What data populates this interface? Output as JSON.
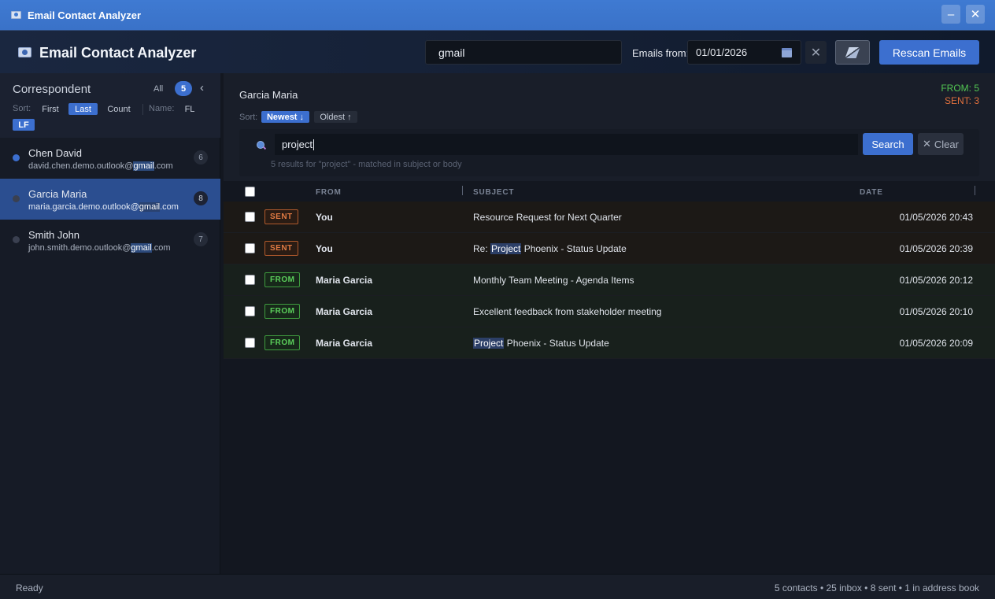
{
  "window": {
    "title": "Email Contact Analyzer",
    "minimize_glyph": "–",
    "close_glyph": "✕"
  },
  "header": {
    "title": "Email Contact Analyzer",
    "search_value": "gmail",
    "emails_from_label": "Emails from:",
    "date_value": "01/01/2026",
    "clear_date_glyph": "✕",
    "rescan_label": "Rescan Emails"
  },
  "sidebar": {
    "title": "Correspondent",
    "all_label": "All",
    "count": "5",
    "collapse_glyph": "‹",
    "sort_label": "Sort:",
    "sort_options": [
      "First",
      "Last",
      "Count"
    ],
    "sort_active": "Last",
    "name_label": "Name:",
    "name_options": [
      "FL",
      "LF"
    ],
    "name_active": "LF",
    "highlight_term": "gmail",
    "contacts": [
      {
        "name": "Chen David",
        "email_prefix": "david.chen.demo.outlook@",
        "email_match": "gmail",
        "email_suffix": ".com",
        "count": "6",
        "dot": "blue",
        "selected": false
      },
      {
        "name": "Garcia Maria",
        "email_prefix": "maria.garcia.demo.outlook@",
        "email_match": "gmail",
        "email_suffix": ".com",
        "count": "8",
        "dot": "grey",
        "selected": true
      },
      {
        "name": "Smith John",
        "email_prefix": "john.smith.demo.outlook@",
        "email_match": "gmail",
        "email_suffix": ".com",
        "count": "7",
        "dot": "grey",
        "selected": false
      }
    ]
  },
  "main": {
    "contact_name": "Garcia Maria",
    "from_stat": "FROM: 5",
    "sent_stat": "SENT: 3",
    "sort_label": "Sort:",
    "sort_newest": "Newest ↓",
    "sort_oldest": "Oldest ↑",
    "search_value": "project",
    "search_button": "Search",
    "clear_button": "Clear",
    "clear_glyph": "✕",
    "results_hint": "5 results for \"project\" - matched in subject or body",
    "columns": {
      "from": "FROM",
      "subject": "SUBJECT",
      "date": "DATE"
    },
    "emails": [
      {
        "type": "sent",
        "badge": "SENT",
        "sender": "You",
        "subject_pre": "",
        "subject_match": "",
        "subject_post": "Resource Request for Next Quarter",
        "date": "01/05/2026 20:43"
      },
      {
        "type": "sent",
        "badge": "SENT",
        "sender": "You",
        "subject_pre": "Re: ",
        "subject_match": "Project",
        "subject_post": " Phoenix - Status Update",
        "date": "01/05/2026 20:39"
      },
      {
        "type": "from",
        "badge": "FROM",
        "sender": "Maria Garcia",
        "subject_pre": "",
        "subject_match": "",
        "subject_post": "Monthly Team Meeting - Agenda Items",
        "date": "01/05/2026 20:12"
      },
      {
        "type": "from",
        "badge": "FROM",
        "sender": "Maria Garcia",
        "subject_pre": "",
        "subject_match": "",
        "subject_post": "Excellent feedback from stakeholder meeting",
        "date": "01/05/2026 20:10"
      },
      {
        "type": "from",
        "badge": "FROM",
        "sender": "Maria Garcia",
        "subject_pre": "",
        "subject_match": "Project",
        "subject_post": " Phoenix - Status Update",
        "date": "01/05/2026 20:09"
      }
    ]
  },
  "status": {
    "left": "Ready",
    "right": "5 contacts • 25 inbox • 8 sent • 1 in address book"
  },
  "colors": {
    "accent": "#3c6fcf",
    "from_green": "#52c552",
    "sent_orange": "#e0703d"
  }
}
